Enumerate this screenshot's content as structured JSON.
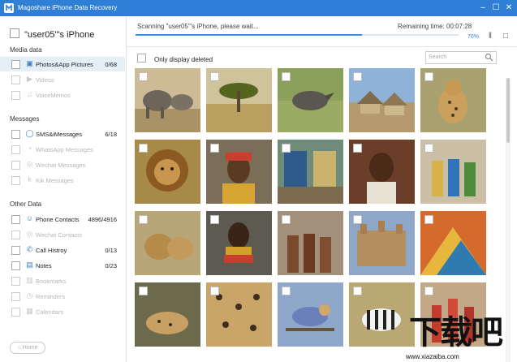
{
  "window": {
    "title": "Magoshare iPhone Data Recovery",
    "controls": [
      "minimize-icon",
      "maximize-icon",
      "close-icon"
    ]
  },
  "sidebar": {
    "device_name": "\"user05\"'s iPhone",
    "sections": [
      {
        "title": "Media data",
        "items": [
          {
            "label": "Photos&App Pictures",
            "count": "0/68",
            "icon": "photo-icon",
            "enabled": true,
            "active": true
          },
          {
            "label": "Videos",
            "count": "",
            "icon": "video-icon",
            "enabled": false
          },
          {
            "label": "VoiceMemos",
            "count": "",
            "icon": "voicememo-icon",
            "enabled": false
          }
        ]
      },
      {
        "title": "Messages",
        "items": [
          {
            "label": "SMS&iMessages",
            "count": "6/18",
            "icon": "message-icon",
            "enabled": true
          },
          {
            "label": "WhatsApp Messages",
            "count": "",
            "icon": "whatsapp-icon",
            "enabled": false
          },
          {
            "label": "Wechat Messages",
            "count": "",
            "icon": "wechat-icon",
            "enabled": false
          },
          {
            "label": "Kik Messages",
            "count": "",
            "icon": "kik-icon",
            "enabled": false
          }
        ]
      },
      {
        "title": "Other Data",
        "items": [
          {
            "label": "Phone Contacts",
            "count": "4896/4916",
            "icon": "contacts-icon",
            "enabled": true
          },
          {
            "label": "Wechat Contacts",
            "count": "",
            "icon": "wechat-icon",
            "enabled": false
          },
          {
            "label": "Call Histroy",
            "count": "0/13",
            "icon": "phone-icon",
            "enabled": true
          },
          {
            "label": "Notes",
            "count": "0/23",
            "icon": "notes-icon",
            "enabled": true
          },
          {
            "label": "Bookmarks",
            "count": "",
            "icon": "bookmark-icon",
            "enabled": false
          },
          {
            "label": "Reminders",
            "count": "",
            "icon": "reminder-icon",
            "enabled": false
          },
          {
            "label": "Calendars",
            "count": "",
            "icon": "calendar-icon",
            "enabled": false
          }
        ]
      }
    ],
    "home_label": "Home"
  },
  "scan": {
    "status": "Scanning \"user05\"'s iPhone, please wait...",
    "remaining": "Remaining time: 00:07:28",
    "progress": 0.7,
    "progress_label": "70%"
  },
  "toolbar": {
    "only_deleted_label": "Only display deleted",
    "search_placeholder": "Search"
  },
  "photos": [
    [
      "elephants",
      "savanna-tree",
      "rhino",
      "huts",
      "cheetah"
    ],
    [
      "lion",
      "tribal-woman",
      "market-stall",
      "child-portrait",
      "villagers"
    ],
    [
      "lions-pair",
      "beaded-woman",
      "group-boys",
      "mud-mosque",
      "colorful-fabric"
    ],
    [
      "leopard-rest",
      "leopard-spots",
      "lilac-roller",
      "zebras",
      "maasai-dancers"
    ]
  ],
  "watermark": {
    "text": "下载吧",
    "url": "www.xiazaiba.com"
  },
  "colors": {
    "titlebar": "#2f7fd6",
    "accent": "#3a8ee6",
    "active_item": "#e6eef8"
  }
}
